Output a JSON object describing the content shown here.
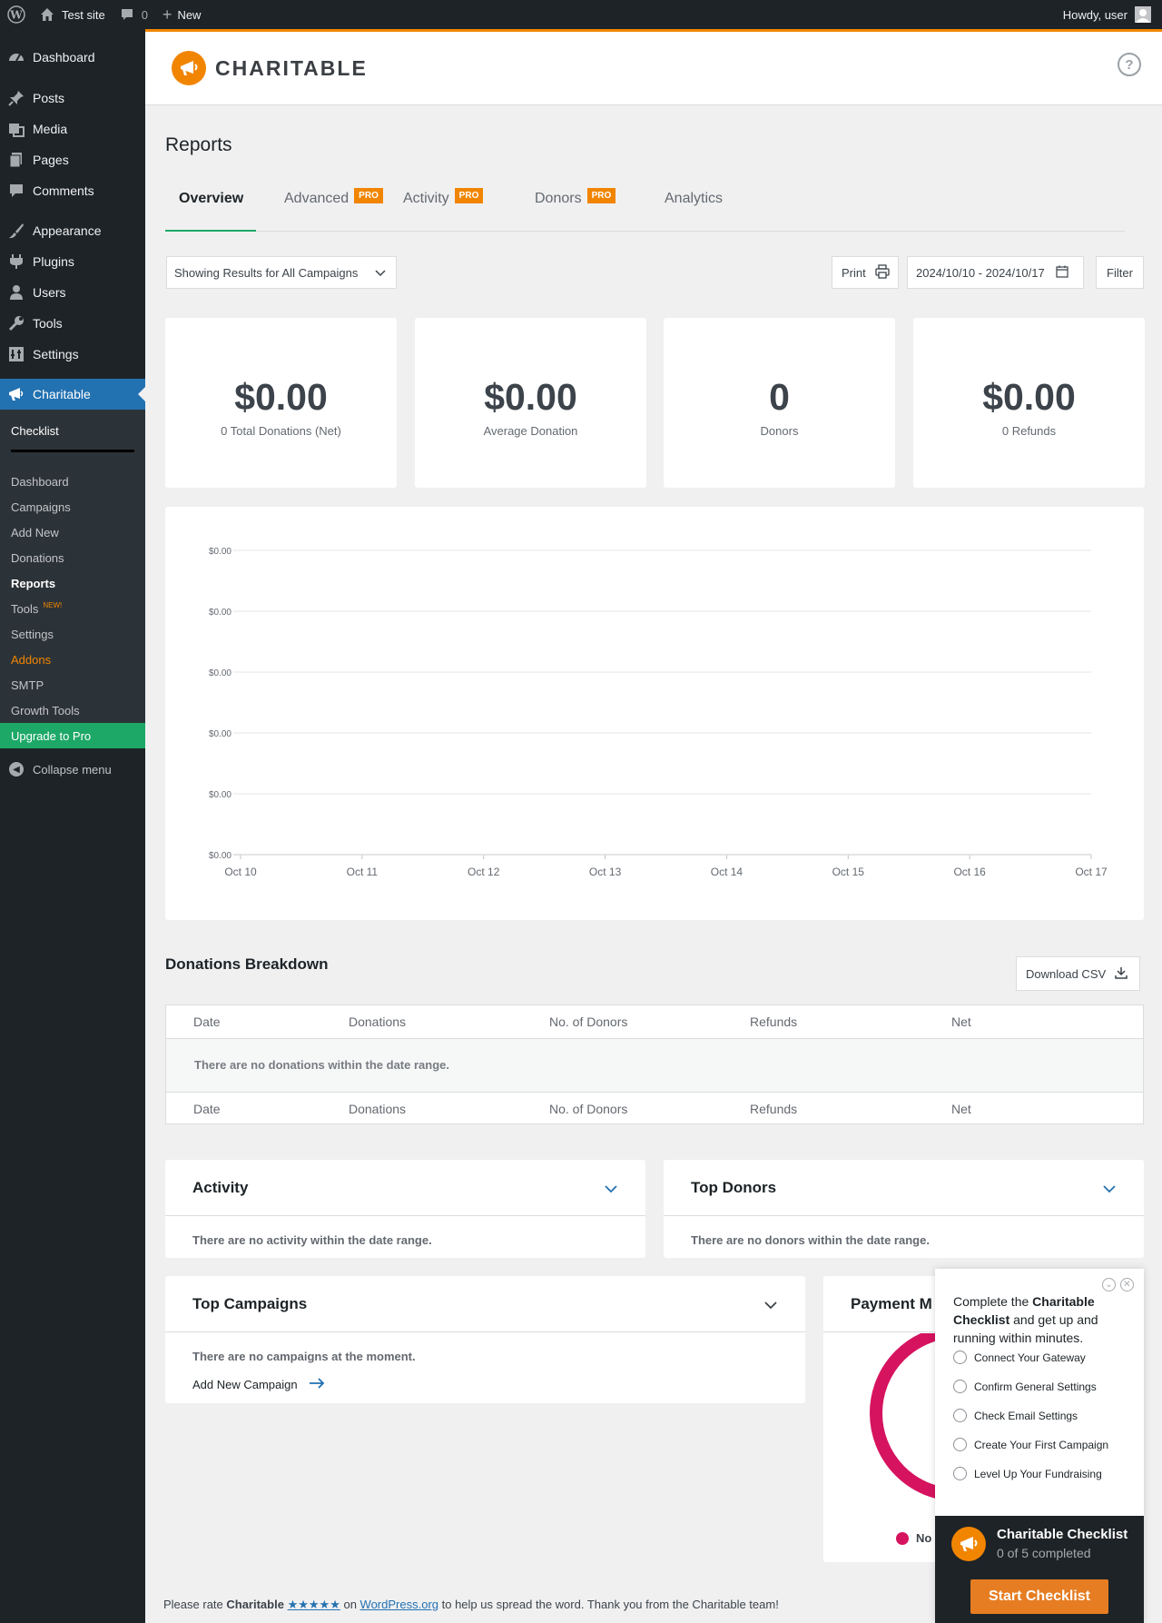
{
  "adminbar": {
    "site_name": "Test site",
    "comments_count": "0",
    "new_label": "New",
    "howdy": "Howdy, user"
  },
  "sidebar": {
    "items": [
      {
        "label": "Dashboard",
        "icon": "dashboard-icon"
      },
      {
        "label": "Posts",
        "icon": "pin-icon"
      },
      {
        "label": "Media",
        "icon": "media-icon"
      },
      {
        "label": "Pages",
        "icon": "pages-icon"
      },
      {
        "label": "Comments",
        "icon": "comment-icon"
      },
      {
        "label": "Appearance",
        "icon": "brush-icon"
      },
      {
        "label": "Plugins",
        "icon": "plugin-icon"
      },
      {
        "label": "Users",
        "icon": "user-icon"
      },
      {
        "label": "Tools",
        "icon": "wrench-icon"
      },
      {
        "label": "Settings",
        "icon": "settings-icon"
      },
      {
        "label": "Charitable",
        "icon": "megaphone-icon"
      }
    ],
    "submenu": {
      "checklist": "Checklist",
      "dashboard": "Dashboard",
      "campaigns": "Campaigns",
      "add_new": "Add New",
      "donations": "Donations",
      "reports": "Reports",
      "tools": "Tools",
      "tools_badge": "NEW!",
      "settings": "Settings",
      "addons": "Addons",
      "smtp": "SMTP",
      "growth_tools": "Growth Tools",
      "upgrade": "Upgrade to Pro"
    },
    "collapse": "Collapse menu"
  },
  "header": {
    "logo_text": "CHARITABLE",
    "help": "?"
  },
  "page": {
    "title": "Reports",
    "tabs": [
      {
        "label": "Overview",
        "pro": ""
      },
      {
        "label": "Advanced",
        "pro": "PRO"
      },
      {
        "label": "Activity",
        "pro": "PRO"
      },
      {
        "label": "Donors",
        "pro": "PRO"
      },
      {
        "label": "Analytics",
        "pro": ""
      }
    ],
    "campaign_filter": "Showing Results for All Campaigns",
    "print_label": "Print",
    "date_range": "2024/10/10 - 2024/10/17",
    "filter_label": "Filter"
  },
  "stats": [
    {
      "value": "$0.00",
      "label": "0 Total Donations (Net)"
    },
    {
      "value": "$0.00",
      "label": "Average Donation"
    },
    {
      "value": "0",
      "label": "Donors"
    },
    {
      "value": "$0.00",
      "label": "0 Refunds"
    }
  ],
  "chart_data": {
    "type": "line",
    "categories": [
      "Oct 10",
      "Oct 11",
      "Oct 12",
      "Oct 13",
      "Oct 14",
      "Oct 15",
      "Oct 16",
      "Oct 17"
    ],
    "series": [
      {
        "values": [
          0,
          0,
          0,
          0,
          0,
          0,
          0,
          0
        ]
      }
    ],
    "y_tick_labels": [
      "$0.00",
      "$0.00",
      "$0.00",
      "$0.00",
      "$0.00",
      "$0.00"
    ],
    "title": "",
    "xlabel": "",
    "ylabel": "",
    "grid": true
  },
  "breakdown": {
    "title": "Donations Breakdown",
    "download_csv": "Download CSV",
    "columns": [
      "Date",
      "Donations",
      "No. of Donors",
      "Refunds",
      "Net"
    ],
    "empty_message": "There are no donations within the date range."
  },
  "panels": {
    "activity": {
      "title": "Activity",
      "empty": "There are no activity within the date range."
    },
    "top_donors": {
      "title": "Top Donors",
      "empty": "There are no donors within the date range."
    },
    "top_campaigns": {
      "title": "Top Campaigns",
      "empty": "There are no campaigns at the moment.",
      "link": "Add New Campaign"
    },
    "payment_methods": {
      "title": "Payment M",
      "legend": "No"
    }
  },
  "checklist_popup": {
    "intro_pre": "Complete the ",
    "intro_bold": "Charitable Checklist",
    "intro_post": " and get up and running within minutes.",
    "items": [
      "Connect Your Gateway",
      "Confirm General Settings",
      "Check Email Settings",
      "Create Your First Campaign",
      "Level Up Your Fundraising"
    ],
    "footer_title": "Charitable Checklist",
    "footer_progress": "0 of 5 completed",
    "start_button": "Start Checklist"
  },
  "footer": {
    "pre": "Please rate ",
    "brand": "Charitable",
    "stars": "★★★★★",
    "mid": " on ",
    "link": "WordPress.org",
    "post": " to help us spread the word. Thank you from the Charitable team!"
  },
  "colors": {
    "accent": "#f18500",
    "wp_blue": "#2271b1",
    "upgrade_green": "#1da867",
    "donut_pink": "#d6135f"
  }
}
